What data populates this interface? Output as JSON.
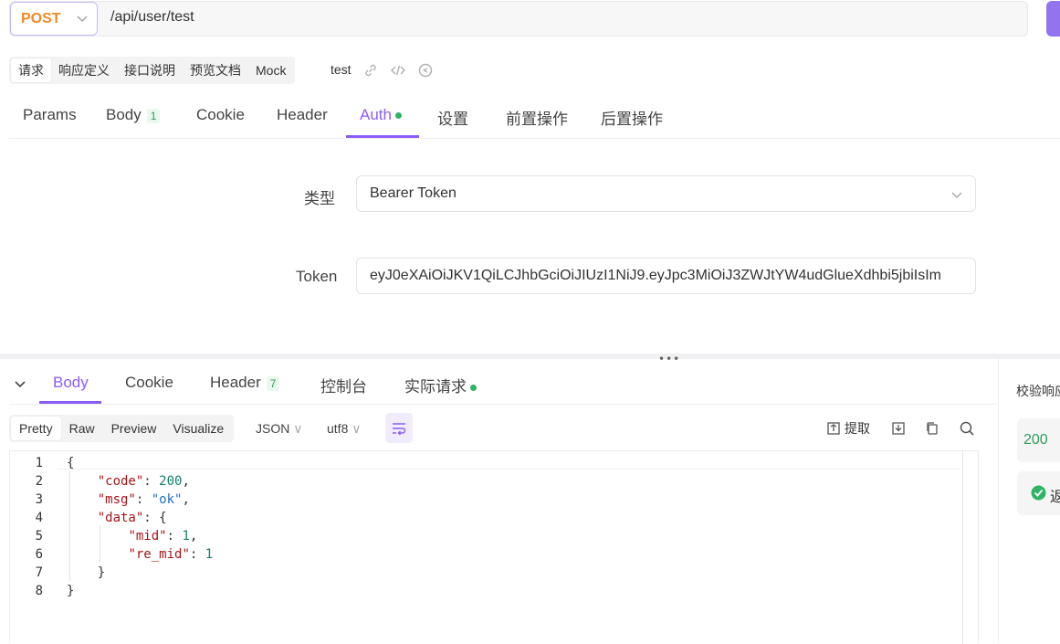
{
  "request": {
    "method": "POST",
    "url": "/api/user/test"
  },
  "subtabs": [
    "请求",
    "响应定义",
    "接口说明",
    "预览文档",
    "Mock"
  ],
  "api_name": "test",
  "main_tabs": {
    "params": "Params",
    "body": "Body",
    "body_count": "1",
    "cookie": "Cookie",
    "header": "Header",
    "auth": "Auth",
    "settings": "设置",
    "pre": "前置操作",
    "post": "后置操作"
  },
  "auth": {
    "type_label": "类型",
    "type_value": "Bearer Token",
    "token_label": "Token",
    "token_value": "eyJ0eXAiOiJKV1QiLCJhbGciOiJIUzI1NiJ9.eyJpc3MiOiJ3ZWJtYW4udGlueXdhbi5jbiIsIm"
  },
  "response_tabs": {
    "body": "Body",
    "cookie": "Cookie",
    "header": "Header",
    "header_count": "7",
    "console": "控制台",
    "actual": "实际请求"
  },
  "format_tabs": [
    "Pretty",
    "Raw",
    "Preview",
    "Visualize"
  ],
  "format_select": "JSON",
  "encoding_select": "utf8",
  "extract_label": "提取",
  "code_lines": [
    "1",
    "2",
    "3",
    "4",
    "5",
    "6",
    "7",
    "8"
  ],
  "right_panel": {
    "title": "校验响应",
    "status": "200",
    "check_text": "返"
  },
  "colors": {
    "accent": "#8b5cf6",
    "method": "#f08a24",
    "success": "#2fb365"
  }
}
